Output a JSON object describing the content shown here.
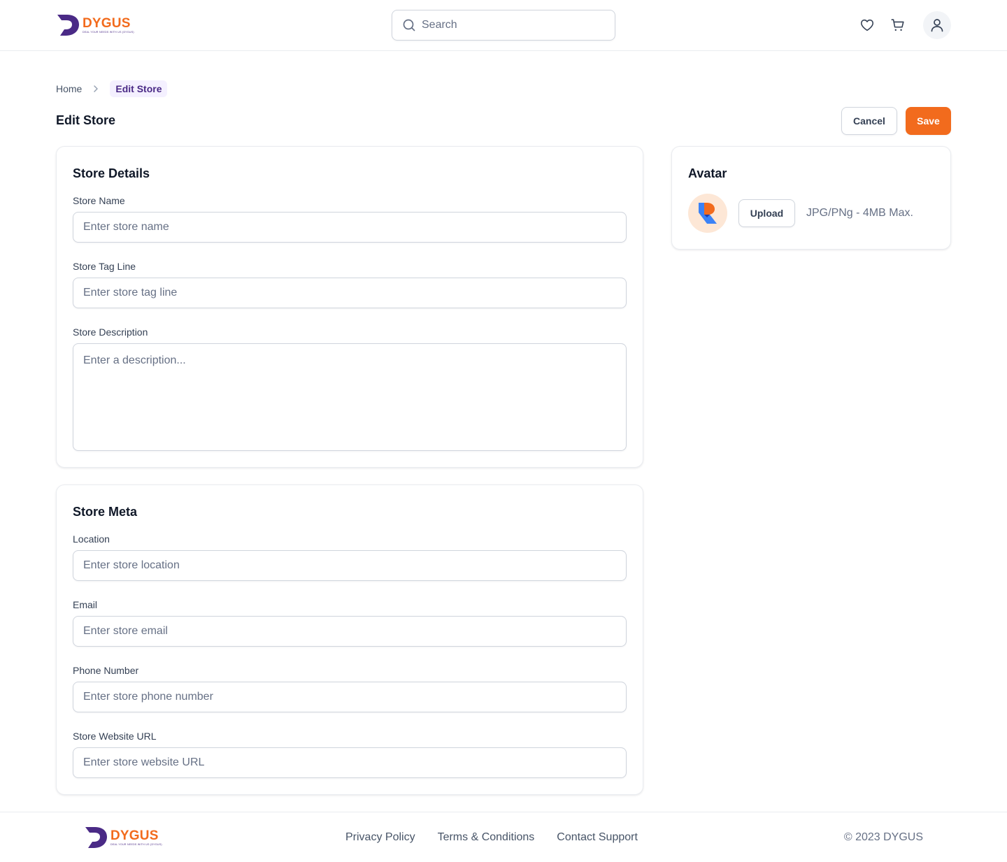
{
  "header": {
    "logo": {
      "brand": "DYGUS",
      "tagline": "DEAL YOUR NEEDS WITH US (DYGUS)"
    },
    "search": {
      "placeholder": "Search"
    },
    "icons": [
      "heart-icon",
      "cart-icon",
      "user-icon"
    ]
  },
  "breadcrumb": {
    "home": "Home",
    "current": "Edit Store"
  },
  "page": {
    "title": "Edit Store",
    "cancel_label": "Cancel",
    "save_label": "Save"
  },
  "store_details": {
    "title": "Store Details",
    "name": {
      "label": "Store Name",
      "placeholder": "Enter store name",
      "value": ""
    },
    "tagline": {
      "label": "Store Tag Line",
      "placeholder": "Enter store tag line",
      "value": ""
    },
    "description": {
      "label": "Store Description",
      "placeholder": "Enter a description...",
      "value": ""
    }
  },
  "store_meta": {
    "title": "Store Meta",
    "location": {
      "label": "Location",
      "placeholder": "Enter store location",
      "value": ""
    },
    "email": {
      "label": "Email",
      "placeholder": "Enter store email",
      "value": ""
    },
    "phone": {
      "label": "Phone Number",
      "placeholder": "Enter store phone number",
      "value": ""
    },
    "website": {
      "label": "Store Website URL",
      "placeholder": "Enter store website URL",
      "value": ""
    }
  },
  "avatar": {
    "title": "Avatar",
    "upload_label": "Upload",
    "hint": "JPG/PNg - 4MB Max."
  },
  "footer": {
    "links": [
      "Privacy Policy",
      "Terms & Conditions",
      "Contact Support"
    ],
    "copyright": "© 2023 DYGUS"
  },
  "colors": {
    "brand_orange": "#f26b1d",
    "brand_purple": "#4a2a86",
    "border": "#d0d5dd",
    "muted_text": "#667085"
  }
}
